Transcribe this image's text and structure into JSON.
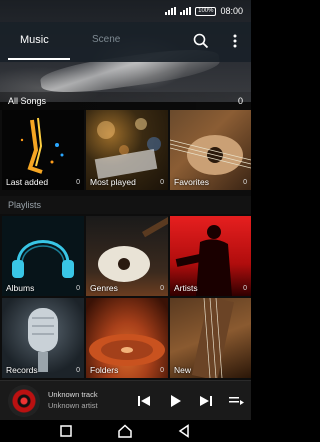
{
  "status_bar": {
    "battery": "100%",
    "time": "08:00"
  },
  "header": {
    "tabs": [
      {
        "label": "Music",
        "active": true
      },
      {
        "label": "Scene",
        "active": false
      }
    ],
    "icons": [
      "search-icon",
      "more-vert-icon"
    ]
  },
  "sections": {
    "all_songs": {
      "title": "All Songs",
      "count": "0"
    },
    "playlists": {
      "title": "Playlists"
    }
  },
  "tiles": {
    "last_added": {
      "label": "Last added",
      "count": "0"
    },
    "most_played": {
      "label": "Most played",
      "count": "0"
    },
    "favorites": {
      "label": "Favorites",
      "count": "0"
    },
    "albums": {
      "label": "Albums",
      "count": "0"
    },
    "genres": {
      "label": "Genres",
      "count": "0"
    },
    "artists": {
      "label": "Artists",
      "count": "0"
    },
    "records": {
      "label": "Records",
      "count": "0"
    },
    "folders": {
      "label": "Folders",
      "count": "0"
    },
    "new": {
      "label": "New"
    }
  },
  "now_playing": {
    "title": "Unknown track",
    "artist": "Unknown artist",
    "icons": [
      "previous-icon",
      "play-icon",
      "next-icon",
      "queue-icon"
    ]
  },
  "nav_bar": {
    "icons": [
      "recent-apps-icon",
      "home-icon",
      "back-icon"
    ]
  },
  "colors": {
    "header_bg": "#19212a",
    "accent": "#ffffff",
    "artists_tile": "#e61f1f"
  }
}
